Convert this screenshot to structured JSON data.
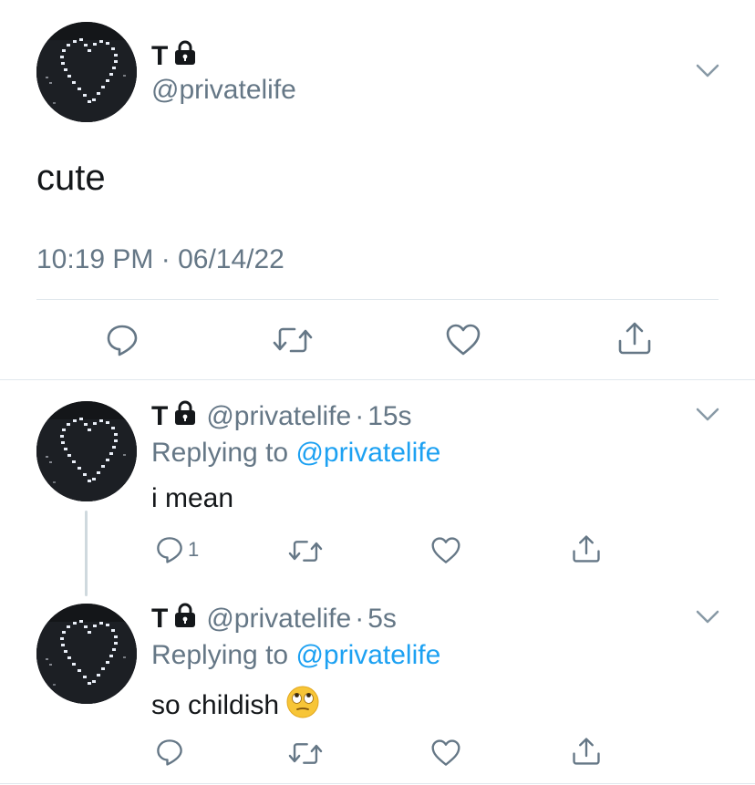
{
  "main_tweet": {
    "display_name": "T",
    "handle": "@privatelife",
    "text": "cute",
    "timestamp": "10:19 PM · 06/14/22",
    "icons": {
      "reply": "reply-icon",
      "retweet": "retweet-icon",
      "like": "heart-icon",
      "share": "share-icon",
      "more": "chevron-down-icon",
      "protected": "lock-icon"
    }
  },
  "replies": [
    {
      "display_name": "T",
      "handle": "@privatelife",
      "dot": "·",
      "time": "15s",
      "replying_prefix": "Replying to",
      "replying_handle": "@privatelife",
      "text": "i mean",
      "reply_count": "1"
    },
    {
      "display_name": "T",
      "handle": "@privatelife",
      "dot": "·",
      "time": "5s",
      "replying_prefix": "Replying to",
      "replying_handle": "@privatelife",
      "text": "so childish",
      "emoji": "eye-roll-emoji",
      "reply_count": ""
    }
  ],
  "colors": {
    "text": "#14171a",
    "muted": "#657786",
    "link": "#1da1f2",
    "divider": "#e1e8ed"
  }
}
